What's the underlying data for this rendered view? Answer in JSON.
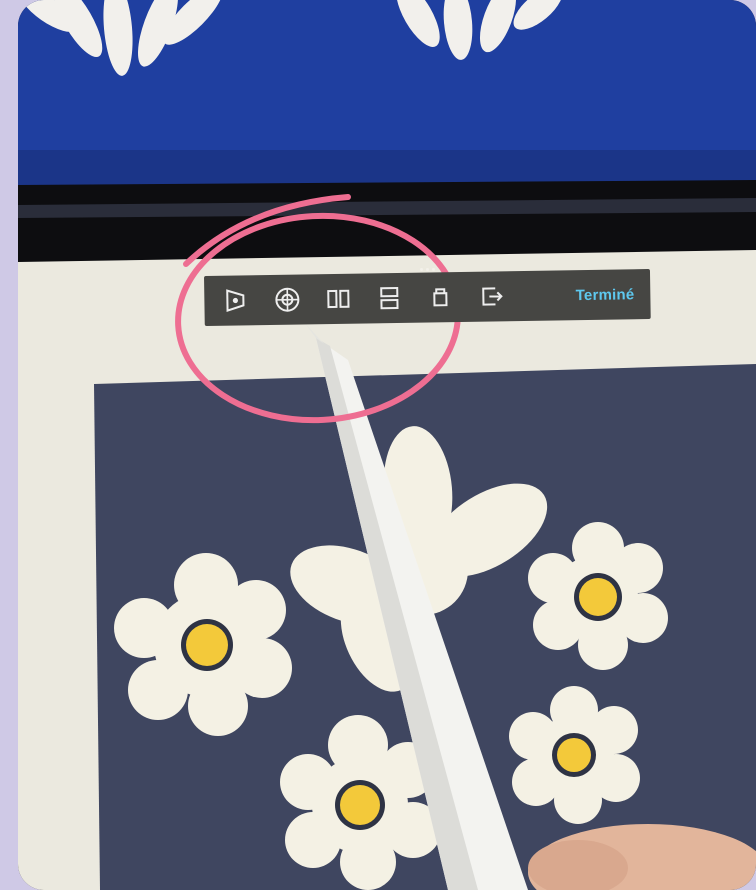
{
  "toolbar": {
    "icons": [
      {
        "name": "perspective-crop-icon"
      },
      {
        "name": "distort-warp-icon"
      },
      {
        "name": "vertical-split-icon"
      },
      {
        "name": "horizontal-split-icon"
      },
      {
        "name": "lock-aspect-icon"
      },
      {
        "name": "export-icon"
      }
    ],
    "done_label": "Terminé"
  },
  "colors": {
    "annotation_circle": "#ee6e92",
    "done_text": "#5ec8ef",
    "toolbar_bg": "#464643",
    "canvas_bg": "#3f4660",
    "flower_petal": "#f4f1e4",
    "flower_center": "#f3c93a",
    "background_fabric": "#1f3fa0"
  }
}
